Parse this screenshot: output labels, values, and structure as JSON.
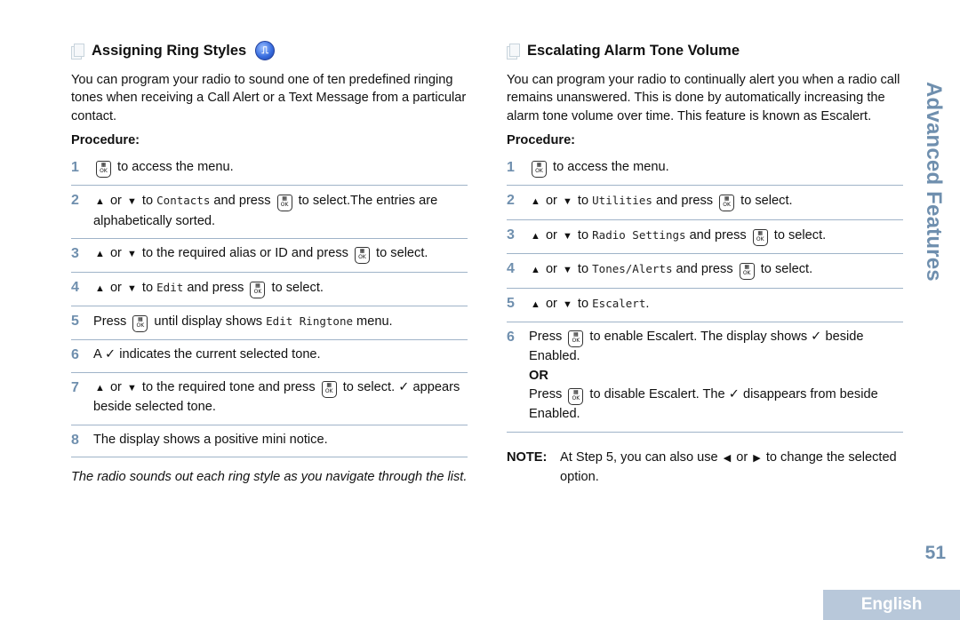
{
  "left": {
    "title": "Assigning Ring Styles",
    "intro": "You can program your radio to sound one of ten predefined ringing tones when receiving a Call Alert or a Text Message from a particular contact.",
    "procedure_label": "Procedure:",
    "steps": [
      {
        "num": "1",
        "parts": [
          {
            "t": "ok"
          },
          {
            "t": "text",
            "v": " to access the menu."
          }
        ]
      },
      {
        "num": "2",
        "parts": [
          {
            "t": "up"
          },
          {
            "t": "text",
            "v": " or "
          },
          {
            "t": "down"
          },
          {
            "t": "text",
            "v": " to "
          },
          {
            "t": "mono",
            "v": "Contacts"
          },
          {
            "t": "text",
            "v": " and press "
          },
          {
            "t": "ok"
          },
          {
            "t": "text",
            "v": " to select.The entries are alphabetically sorted."
          }
        ]
      },
      {
        "num": "3",
        "parts": [
          {
            "t": "up"
          },
          {
            "t": "text",
            "v": " or "
          },
          {
            "t": "down"
          },
          {
            "t": "text",
            "v": " to the required alias or ID and press "
          },
          {
            "t": "ok"
          },
          {
            "t": "text",
            "v": " to select."
          }
        ]
      },
      {
        "num": "4",
        "parts": [
          {
            "t": "up"
          },
          {
            "t": "text",
            "v": " or "
          },
          {
            "t": "down"
          },
          {
            "t": "text",
            "v": " to "
          },
          {
            "t": "mono",
            "v": "Edit"
          },
          {
            "t": "text",
            "v": " and press "
          },
          {
            "t": "ok"
          },
          {
            "t": "text",
            "v": " to select."
          }
        ]
      },
      {
        "num": "5",
        "parts": [
          {
            "t": "text",
            "v": "Press "
          },
          {
            "t": "ok"
          },
          {
            "t": "text",
            "v": " until display shows "
          },
          {
            "t": "mono",
            "v": "Edit Ringtone"
          },
          {
            "t": "text",
            "v": " menu."
          }
        ]
      },
      {
        "num": "6",
        "parts": [
          {
            "t": "text",
            "v": "A ✓ indicates the current selected tone."
          }
        ]
      },
      {
        "num": "7",
        "parts": [
          {
            "t": "up"
          },
          {
            "t": "text",
            "v": " or "
          },
          {
            "t": "down"
          },
          {
            "t": "text",
            "v": " to the required tone and press "
          },
          {
            "t": "ok"
          },
          {
            "t": "text",
            "v": " to select. ✓ appears beside selected tone."
          }
        ]
      },
      {
        "num": "8",
        "parts": [
          {
            "t": "text",
            "v": "The display shows a positive mini notice."
          }
        ]
      }
    ],
    "footnote": "The radio sounds out each ring style as you navigate through the list."
  },
  "right": {
    "title": "Escalating Alarm Tone Volume",
    "intro": "You can program your radio to continually alert you when a radio call remains unanswered. This is done by automatically increasing the alarm tone volume over time. This feature is known as Escalert.",
    "procedure_label": "Procedure:",
    "steps": [
      {
        "num": "1",
        "parts": [
          {
            "t": "ok"
          },
          {
            "t": "text",
            "v": " to access the menu."
          }
        ]
      },
      {
        "num": "2",
        "parts": [
          {
            "t": "up"
          },
          {
            "t": "text",
            "v": " or "
          },
          {
            "t": "down"
          },
          {
            "t": "text",
            "v": " to "
          },
          {
            "t": "mono",
            "v": "Utilities"
          },
          {
            "t": "text",
            "v": " and press "
          },
          {
            "t": "ok"
          },
          {
            "t": "text",
            "v": " to select."
          }
        ]
      },
      {
        "num": "3",
        "parts": [
          {
            "t": "up"
          },
          {
            "t": "text",
            "v": " or "
          },
          {
            "t": "down"
          },
          {
            "t": "text",
            "v": " to "
          },
          {
            "t": "mono",
            "v": "Radio Settings"
          },
          {
            "t": "text",
            "v": " and press "
          },
          {
            "t": "ok"
          },
          {
            "t": "text",
            "v": " to select."
          }
        ]
      },
      {
        "num": "4",
        "parts": [
          {
            "t": "up"
          },
          {
            "t": "text",
            "v": " or "
          },
          {
            "t": "down"
          },
          {
            "t": "text",
            "v": " to "
          },
          {
            "t": "mono",
            "v": "Tones/Alerts"
          },
          {
            "t": "text",
            "v": " and press "
          },
          {
            "t": "ok"
          },
          {
            "t": "text",
            "v": " to select."
          }
        ]
      },
      {
        "num": "5",
        "parts": [
          {
            "t": "up"
          },
          {
            "t": "text",
            "v": " or "
          },
          {
            "t": "down"
          },
          {
            "t": "text",
            "v": " to "
          },
          {
            "t": "mono",
            "v": "Escalert"
          },
          {
            "t": "text",
            "v": "."
          }
        ]
      },
      {
        "num": "6",
        "parts": [
          {
            "t": "text",
            "v": "Press "
          },
          {
            "t": "ok"
          },
          {
            "t": "text",
            "v": " to enable Escalert. The display shows ✓ beside Enabled."
          },
          {
            "t": "br"
          },
          {
            "t": "bold",
            "v": "OR"
          },
          {
            "t": "br"
          },
          {
            "t": "text",
            "v": "Press "
          },
          {
            "t": "ok"
          },
          {
            "t": "text",
            "v": " to disable Escalert. The ✓ disappears from beside Enabled."
          }
        ]
      }
    ],
    "note_label": "NOTE:",
    "note_parts": [
      {
        "t": "text",
        "v": "At Step 5, you can also use "
      },
      {
        "t": "left"
      },
      {
        "t": "text",
        "v": " or "
      },
      {
        "t": "right"
      },
      {
        "t": "text",
        "v": " to change the selected option."
      }
    ]
  },
  "side_title": "Advanced Features",
  "page_number": "51",
  "language_tab": "English",
  "icons": {
    "ok": "menu-ok-button-icon",
    "up": "up-arrow-icon",
    "down": "down-arrow-icon",
    "left": "left-arrow-icon",
    "right": "right-arrow-icon"
  }
}
